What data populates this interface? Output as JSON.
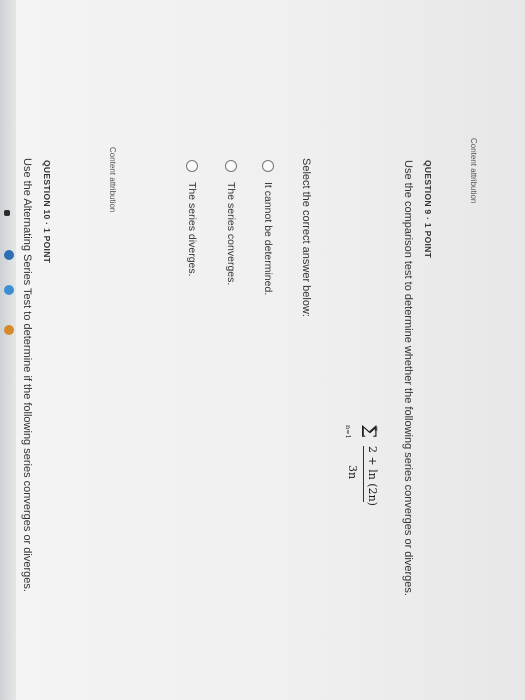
{
  "content_attribution_top": "Content attribution",
  "question9": {
    "title": "QUESTION 9 · 1 POINT",
    "prompt": "Use the comparison test to determine whether the following series converges or diverges.",
    "math": {
      "sum_top": "∞",
      "sum_symbol": "Σ",
      "sum_bottom": "n=1",
      "numerator": "2 + ln (2n)",
      "denominator": "3n"
    },
    "select_label": "Select the correct answer below:",
    "options": [
      {
        "label": "It cannot be determined."
      },
      {
        "label": "The series converges."
      },
      {
        "label": "The series diverges."
      }
    ]
  },
  "content_attribution_bottom": "Content attribution",
  "question10": {
    "title": "QUESTION 10 · 1 POINT",
    "prompt": "Use the Alternating Series Test to determine if the following series converges or diverges."
  }
}
